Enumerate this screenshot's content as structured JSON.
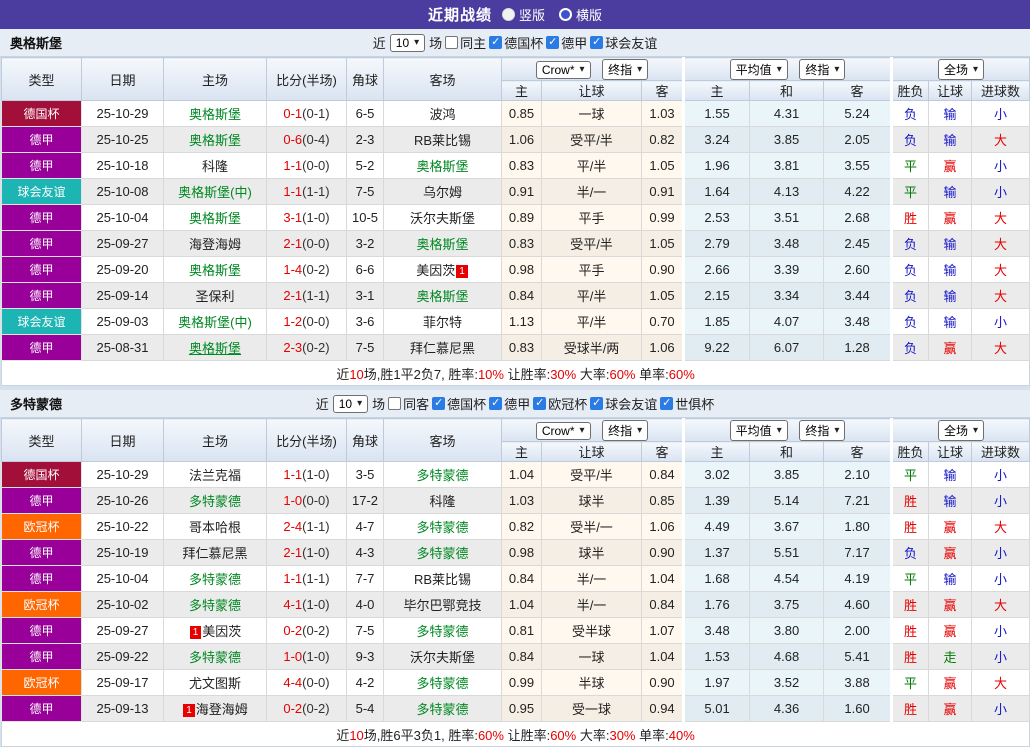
{
  "header": {
    "title": "近期战绩",
    "radio_vertical": "竖版",
    "radio_horizontal": "横版"
  },
  "dropdowns": {
    "company": "Crow*",
    "final": "终指",
    "average": "平均值",
    "scope": "全场"
  },
  "columns": {
    "type": "类型",
    "date": "日期",
    "home": "主场",
    "score": "比分(半场)",
    "corner": "角球",
    "away": "客场",
    "odds_home": "主",
    "odds_handicap": "让球",
    "odds_away": "客",
    "avg_home": "主",
    "avg_draw": "和",
    "avg_away": "客",
    "wdl": "胜负",
    "let_goal": "让球",
    "goals": "进球数"
  },
  "type_colors": {
    "德国杯": "#A2103A",
    "德甲": "#990099",
    "球会友谊": "#1DB4B4",
    "欧冠杯": "#FF6600"
  },
  "result_colors": {
    "胜": "#E60000",
    "赢": "#E60000",
    "大": "#E60000",
    "负": "#1515C8",
    "输": "#1515C8",
    "小": "#1515C8",
    "平": "#007A00",
    "走": "#007A00"
  },
  "sections": [
    {
      "team": "奥格斯堡",
      "filter": {
        "near_label": "近",
        "count": "10",
        "games_label": "场",
        "same": {
          "label": "同主",
          "checked": false
        },
        "leagues": [
          {
            "label": "德国杯",
            "checked": true
          },
          {
            "label": "德甲",
            "checked": true
          },
          {
            "label": "球会友谊",
            "checked": true
          }
        ]
      },
      "rows": [
        {
          "type": "德国杯",
          "date": "25-10-29",
          "home": {
            "name": "奥格斯堡",
            "green": true
          },
          "ft": "0-1",
          "ht": "(0-1)",
          "corner": "6-5",
          "away": {
            "name": "波鸿",
            "green": false
          },
          "odds": [
            "0.85",
            "一球",
            "1.03"
          ],
          "avg": [
            "1.55",
            "4.31",
            "5.24"
          ],
          "res": [
            "负",
            "输",
            "小"
          ]
        },
        {
          "type": "德甲",
          "date": "25-10-25",
          "home": {
            "name": "奥格斯堡",
            "green": true
          },
          "ft": "0-6",
          "ht": "(0-4)",
          "corner": "2-3",
          "away": {
            "name": "RB莱比锡",
            "green": false
          },
          "odds": [
            "1.06",
            "受平/半",
            "0.82"
          ],
          "avg": [
            "3.24",
            "3.85",
            "2.05"
          ],
          "res": [
            "负",
            "输",
            "大"
          ]
        },
        {
          "type": "德甲",
          "date": "25-10-18",
          "home": {
            "name": "科隆",
            "green": false
          },
          "ft": "1-1",
          "ht": "(0-0)",
          "corner": "5-2",
          "away": {
            "name": "奥格斯堡",
            "green": true
          },
          "odds": [
            "0.83",
            "平/半",
            "1.05"
          ],
          "avg": [
            "1.96",
            "3.81",
            "3.55"
          ],
          "res": [
            "平",
            "赢",
            "小"
          ]
        },
        {
          "type": "球会友谊",
          "date": "25-10-08",
          "home": {
            "name": "奥格斯堡(中)",
            "green": true
          },
          "ft": "1-1",
          "ht": "(1-1)",
          "corner": "7-5",
          "away": {
            "name": "乌尔姆",
            "green": false
          },
          "odds": [
            "0.91",
            "半/一",
            "0.91"
          ],
          "avg": [
            "1.64",
            "4.13",
            "4.22"
          ],
          "res": [
            "平",
            "输",
            "小"
          ]
        },
        {
          "type": "德甲",
          "date": "25-10-04",
          "home": {
            "name": "奥格斯堡",
            "green": true
          },
          "ft": "3-1",
          "ht": "(1-0)",
          "corner": "10-5",
          "away": {
            "name": "沃尔夫斯堡",
            "green": false
          },
          "odds": [
            "0.89",
            "平手",
            "0.99"
          ],
          "avg": [
            "2.53",
            "3.51",
            "2.68"
          ],
          "res": [
            "胜",
            "赢",
            "大"
          ]
        },
        {
          "type": "德甲",
          "date": "25-09-27",
          "home": {
            "name": "海登海姆",
            "green": false
          },
          "ft": "2-1",
          "ht": "(0-0)",
          "corner": "3-2",
          "away": {
            "name": "奥格斯堡",
            "green": true
          },
          "odds": [
            "0.83",
            "受平/半",
            "1.05"
          ],
          "avg": [
            "2.79",
            "3.48",
            "2.45"
          ],
          "res": [
            "负",
            "输",
            "大"
          ]
        },
        {
          "type": "德甲",
          "date": "25-09-20",
          "home": {
            "name": "奥格斯堡",
            "green": true
          },
          "ft": "1-4",
          "ht": "(0-2)",
          "corner": "6-6",
          "away": {
            "name": "美因茨",
            "green": false,
            "badge_after": "1"
          },
          "odds": [
            "0.98",
            "平手",
            "0.90"
          ],
          "avg": [
            "2.66",
            "3.39",
            "2.60"
          ],
          "res": [
            "负",
            "输",
            "大"
          ]
        },
        {
          "type": "德甲",
          "date": "25-09-14",
          "home": {
            "name": "圣保利",
            "green": false
          },
          "ft": "2-1",
          "ht": "(1-1)",
          "corner": "3-1",
          "away": {
            "name": "奥格斯堡",
            "green": true
          },
          "odds": [
            "0.84",
            "平/半",
            "1.05"
          ],
          "avg": [
            "2.15",
            "3.34",
            "3.44"
          ],
          "res": [
            "负",
            "输",
            "大"
          ]
        },
        {
          "type": "球会友谊",
          "date": "25-09-03",
          "home": {
            "name": "奥格斯堡(中)",
            "green": true
          },
          "ft": "1-2",
          "ht": "(0-0)",
          "corner": "3-6",
          "away": {
            "name": "菲尔特",
            "green": false
          },
          "odds": [
            "1.13",
            "平/半",
            "0.70"
          ],
          "avg": [
            "1.85",
            "4.07",
            "3.48"
          ],
          "res": [
            "负",
            "输",
            "小"
          ]
        },
        {
          "type": "德甲",
          "date": "25-08-31",
          "home": {
            "name": "奥格斯堡",
            "green": true,
            "underline": true
          },
          "ft": "2-3",
          "ht": "(0-2)",
          "corner": "7-5",
          "away": {
            "name": "拜仁慕尼黑",
            "green": false
          },
          "odds": [
            "0.83",
            "受球半/两",
            "1.06"
          ],
          "avg": [
            "9.22",
            "6.07",
            "1.28"
          ],
          "res": [
            "负",
            "赢",
            "大"
          ]
        }
      ],
      "summary": [
        {
          "text": "近",
          "red": false
        },
        {
          "text": "10",
          "red": true
        },
        {
          "text": "场,胜1平2负7, 胜率:",
          "red": false
        },
        {
          "text": "10%",
          "red": true
        },
        {
          "text": " 让胜率:",
          "red": false
        },
        {
          "text": "30%",
          "red": true
        },
        {
          "text": " 大率:",
          "red": false
        },
        {
          "text": "60%",
          "red": true
        },
        {
          "text": " 单率:",
          "red": false
        },
        {
          "text": "60%",
          "red": true
        }
      ]
    },
    {
      "team": "多特蒙德",
      "filter": {
        "near_label": "近",
        "count": "10",
        "games_label": "场",
        "same": {
          "label": "同客",
          "checked": false
        },
        "leagues": [
          {
            "label": "德国杯",
            "checked": true
          },
          {
            "label": "德甲",
            "checked": true
          },
          {
            "label": "欧冠杯",
            "checked": true
          },
          {
            "label": "球会友谊",
            "checked": true
          },
          {
            "label": "世俱杯",
            "checked": true
          }
        ]
      },
      "rows": [
        {
          "type": "德国杯",
          "date": "25-10-29",
          "home": {
            "name": "法兰克福",
            "green": false
          },
          "ft": "1-1",
          "ht": "(1-0)",
          "corner": "3-5",
          "away": {
            "name": "多特蒙德",
            "green": true
          },
          "odds": [
            "1.04",
            "受平/半",
            "0.84"
          ],
          "avg": [
            "3.02",
            "3.85",
            "2.10"
          ],
          "res": [
            "平",
            "输",
            "小"
          ]
        },
        {
          "type": "德甲",
          "date": "25-10-26",
          "home": {
            "name": "多特蒙德",
            "green": true
          },
          "ft": "1-0",
          "ht": "(0-0)",
          "corner": "17-2",
          "away": {
            "name": "科隆",
            "green": false
          },
          "odds": [
            "1.03",
            "球半",
            "0.85"
          ],
          "avg": [
            "1.39",
            "5.14",
            "7.21"
          ],
          "res": [
            "胜",
            "输",
            "小"
          ]
        },
        {
          "type": "欧冠杯",
          "date": "25-10-22",
          "home": {
            "name": "哥本哈根",
            "green": false
          },
          "ft": "2-4",
          "ht": "(1-1)",
          "corner": "4-7",
          "away": {
            "name": "多特蒙德",
            "green": true
          },
          "odds": [
            "0.82",
            "受半/一",
            "1.06"
          ],
          "avg": [
            "4.49",
            "3.67",
            "1.80"
          ],
          "res": [
            "胜",
            "赢",
            "大"
          ]
        },
        {
          "type": "德甲",
          "date": "25-10-19",
          "home": {
            "name": "拜仁慕尼黑",
            "green": false
          },
          "ft": "2-1",
          "ht": "(1-0)",
          "corner": "4-3",
          "away": {
            "name": "多特蒙德",
            "green": true
          },
          "odds": [
            "0.98",
            "球半",
            "0.90"
          ],
          "avg": [
            "1.37",
            "5.51",
            "7.17"
          ],
          "res": [
            "负",
            "赢",
            "小"
          ]
        },
        {
          "type": "德甲",
          "date": "25-10-04",
          "home": {
            "name": "多特蒙德",
            "green": true
          },
          "ft": "1-1",
          "ht": "(1-1)",
          "corner": "7-7",
          "away": {
            "name": "RB莱比锡",
            "green": false
          },
          "odds": [
            "0.84",
            "半/一",
            "1.04"
          ],
          "avg": [
            "1.68",
            "4.54",
            "4.19"
          ],
          "res": [
            "平",
            "输",
            "小"
          ]
        },
        {
          "type": "欧冠杯",
          "date": "25-10-02",
          "home": {
            "name": "多特蒙德",
            "green": true
          },
          "ft": "4-1",
          "ht": "(1-0)",
          "corner": "4-0",
          "away": {
            "name": "毕尔巴鄂竞技",
            "green": false
          },
          "odds": [
            "1.04",
            "半/一",
            "0.84"
          ],
          "avg": [
            "1.76",
            "3.75",
            "4.60"
          ],
          "res": [
            "胜",
            "赢",
            "大"
          ]
        },
        {
          "type": "德甲",
          "date": "25-09-27",
          "home": {
            "name": "美因茨",
            "green": false,
            "badge_before": "1"
          },
          "ft": "0-2",
          "ht": "(0-2)",
          "corner": "7-5",
          "away": {
            "name": "多特蒙德",
            "green": true
          },
          "odds": [
            "0.81",
            "受半球",
            "1.07"
          ],
          "avg": [
            "3.48",
            "3.80",
            "2.00"
          ],
          "res": [
            "胜",
            "赢",
            "小"
          ]
        },
        {
          "type": "德甲",
          "date": "25-09-22",
          "home": {
            "name": "多特蒙德",
            "green": true
          },
          "ft": "1-0",
          "ht": "(1-0)",
          "corner": "9-3",
          "away": {
            "name": "沃尔夫斯堡",
            "green": false
          },
          "odds": [
            "0.84",
            "一球",
            "1.04"
          ],
          "avg": [
            "1.53",
            "4.68",
            "5.41"
          ],
          "res": [
            "胜",
            "走",
            "小"
          ]
        },
        {
          "type": "欧冠杯",
          "date": "25-09-17",
          "home": {
            "name": "尤文图斯",
            "green": false
          },
          "ft": "4-4",
          "ht": "(0-0)",
          "corner": "4-2",
          "away": {
            "name": "多特蒙德",
            "green": true
          },
          "odds": [
            "0.99",
            "半球",
            "0.90"
          ],
          "avg": [
            "1.97",
            "3.52",
            "3.88"
          ],
          "res": [
            "平",
            "赢",
            "大"
          ]
        },
        {
          "type": "德甲",
          "date": "25-09-13",
          "home": {
            "name": "海登海姆",
            "green": false,
            "badge_before": "1"
          },
          "ft": "0-2",
          "ht": "(0-2)",
          "corner": "5-4",
          "away": {
            "name": "多特蒙德",
            "green": true
          },
          "odds": [
            "0.95",
            "受一球",
            "0.94"
          ],
          "avg": [
            "5.01",
            "4.36",
            "1.60"
          ],
          "res": [
            "胜",
            "赢",
            "小"
          ]
        }
      ],
      "summary": [
        {
          "text": "近",
          "red": false
        },
        {
          "text": "10",
          "red": true
        },
        {
          "text": "场,胜6平3负1, 胜率:",
          "red": false
        },
        {
          "text": "60%",
          "red": true
        },
        {
          "text": " 让胜率:",
          "red": false
        },
        {
          "text": "60%",
          "red": true
        },
        {
          "text": " 大率:",
          "red": false
        },
        {
          "text": "30%",
          "red": true
        },
        {
          "text": " 单率:",
          "red": false
        },
        {
          "text": "40%",
          "red": true
        }
      ]
    }
  ]
}
